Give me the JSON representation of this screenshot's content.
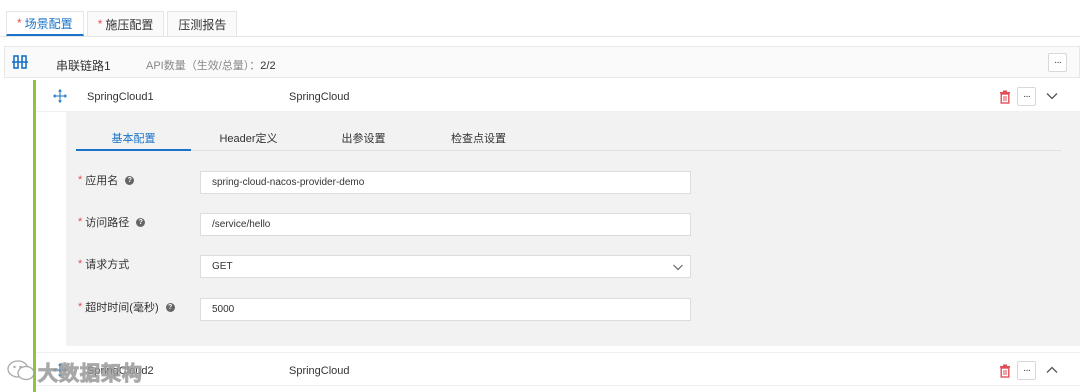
{
  "tabs": [
    {
      "label": "场景配置",
      "required": "*",
      "active": true
    },
    {
      "label": "施压配置",
      "required": "*",
      "active": false
    },
    {
      "label": "压测报告",
      "required": "",
      "active": false
    }
  ],
  "chain": {
    "title": "串联链路1",
    "count_label": "API数量（生效/总量）：",
    "count_value": "2/2",
    "more": "···"
  },
  "nodes": [
    {
      "name": "SpringCloud1",
      "type": "SpringCloud",
      "more": "···",
      "expanded": true
    },
    {
      "name": "SpringCloud2",
      "type": "SpringCloud",
      "more": "···",
      "expanded": false
    }
  ],
  "sub_tabs": [
    "基本配置",
    "Header定义",
    "出参设置",
    "检查点设置"
  ],
  "fields": [
    {
      "label": "应用名",
      "required": "*",
      "help": "?",
      "value": "spring-cloud-nacos-provider-demo"
    },
    {
      "label": "访问路径",
      "required": "*",
      "help": "?",
      "value": "/service/hello"
    },
    {
      "label": "请求方式",
      "required": "*",
      "help": "",
      "value": "GET"
    },
    {
      "label": "超时时间(毫秒)",
      "required": "*",
      "help": "?",
      "value": "5000"
    }
  ],
  "watermark": "大数据架构",
  "colors": {
    "accent": "#1a73c8",
    "required": "#e34d59",
    "chain_bar": "#8cc63f",
    "delete": "#e34d59"
  }
}
